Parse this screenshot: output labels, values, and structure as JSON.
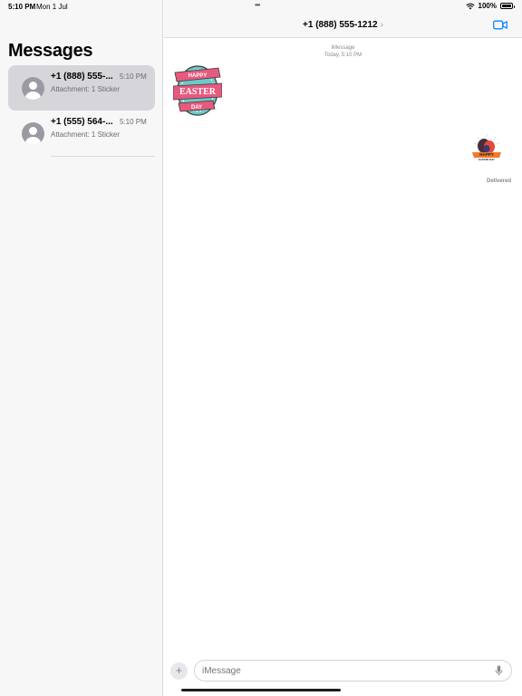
{
  "status_bar": {
    "time": "5:10 PM",
    "date": "Mon 1 Jul",
    "battery": "100%",
    "battery_level": 1.0
  },
  "sidebar": {
    "title": "Messages",
    "conversations": [
      {
        "name": "+1 (888) 555-...",
        "time": "5:10 PM",
        "preview": "Attachment: 1 Sticker",
        "selected": true
      },
      {
        "name": "+1 (555) 564-...",
        "time": "5:10 PM",
        "preview": "Attachment: 1 Sticker",
        "selected": false
      }
    ]
  },
  "header": {
    "contact": "+1 (888) 555-1212",
    "chevron": "›",
    "video_icon": "video-camera-icon"
  },
  "thread": {
    "service": "iMessage",
    "timestamp": "Today, 5:10 PM",
    "incoming_sticker": {
      "icon": "easter-egg-sticker",
      "lines": [
        "HAPPY",
        "EASTER",
        "DAY"
      ]
    },
    "outgoing_sticker": {
      "icon": "easter-bunny-sticker",
      "lines": [
        "HAPPY",
        "EASTER DAY"
      ]
    },
    "status": "Delivered"
  },
  "composer": {
    "placeholder": "iMessage",
    "plus_icon": "plus-icon",
    "mic_icon": "microphone-icon"
  },
  "colors": {
    "accent": "#0a84ff",
    "selected_row": "#d5d5da",
    "sticker_teal": "#6ec9c9",
    "sticker_pink": "#e65a7e"
  }
}
